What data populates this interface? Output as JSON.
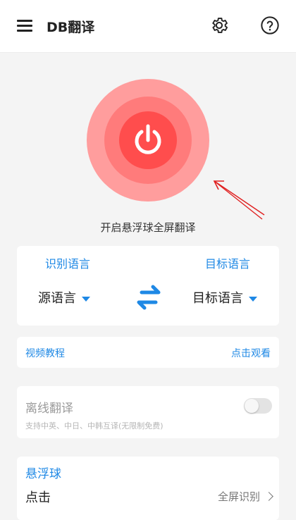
{
  "appbar": {
    "title": "DB翻译",
    "icons": [
      "menu-icon",
      "gear-icon",
      "help-icon"
    ]
  },
  "power": {
    "label": "开启悬浮球全屏翻译",
    "colors": {
      "outer": "#ff9d9d",
      "middle": "#ff7b7b",
      "inner": "#ff4d4d",
      "arrow": "#e02020"
    }
  },
  "language": {
    "source_heading": "识别语言",
    "target_heading": "目标语言",
    "source_value": "源语言",
    "target_value": "目标语言",
    "accent": "#1e88e5"
  },
  "tutorial": {
    "label": "视频教程",
    "action": "点击观看"
  },
  "offline": {
    "title": "离线翻译",
    "subtitle": "支持中英、中日、中韩互译(无限制免费)",
    "enabled": false
  },
  "float_ball": {
    "title": "悬浮球",
    "click_label": "点击",
    "click_value": "全屏识别"
  }
}
